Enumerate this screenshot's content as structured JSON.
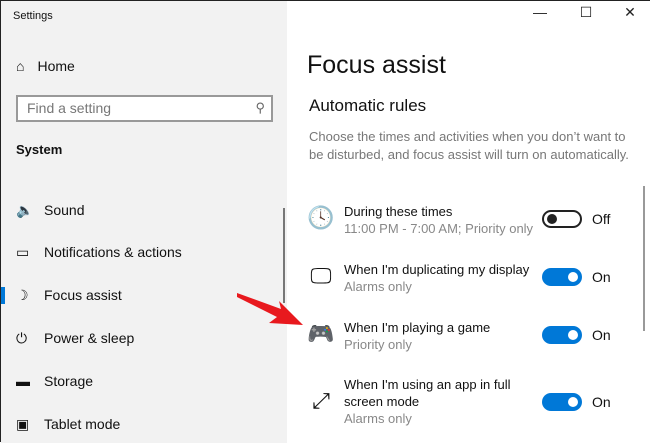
{
  "window": {
    "title": "Settings",
    "minimize": "—",
    "maximize": "☐",
    "close": "✕"
  },
  "sidebar": {
    "home": "Home",
    "search_placeholder": "Find a setting",
    "section": "System",
    "items": [
      {
        "label": "Sound",
        "icon": "🔈"
      },
      {
        "label": "Notifications & actions",
        "icon": "▭"
      },
      {
        "label": "Focus assist",
        "icon": "☽"
      },
      {
        "label": "Power & sleep",
        "icon": "⏻"
      },
      {
        "label": "Storage",
        "icon": "▬"
      },
      {
        "label": "Tablet mode",
        "icon": "▣"
      }
    ]
  },
  "main": {
    "title": "Focus assist",
    "subtitle": "Automatic rules",
    "description": "Choose the times and activities when you don’t want to be disturbed, and focus assist will turn on automatically.",
    "rules": [
      {
        "title": "During these times",
        "sub": "11:00 PM - 7:00 AM; Priority only",
        "state": "Off",
        "on": false,
        "icon": "🕓"
      },
      {
        "title": "When I'm duplicating my display",
        "sub": "Alarms only",
        "state": "On",
        "on": true,
        "icon": "🖵"
      },
      {
        "title": "When I'm playing a game",
        "sub": "Priority only",
        "state": "On",
        "on": true,
        "icon": "🎮"
      },
      {
        "title": "When I'm using an app in full screen mode",
        "sub": "Alarms only",
        "state": "On",
        "on": true,
        "icon": "⤢"
      }
    ]
  },
  "colors": {
    "accent": "#0078d7",
    "arrow": "#e8191e"
  }
}
